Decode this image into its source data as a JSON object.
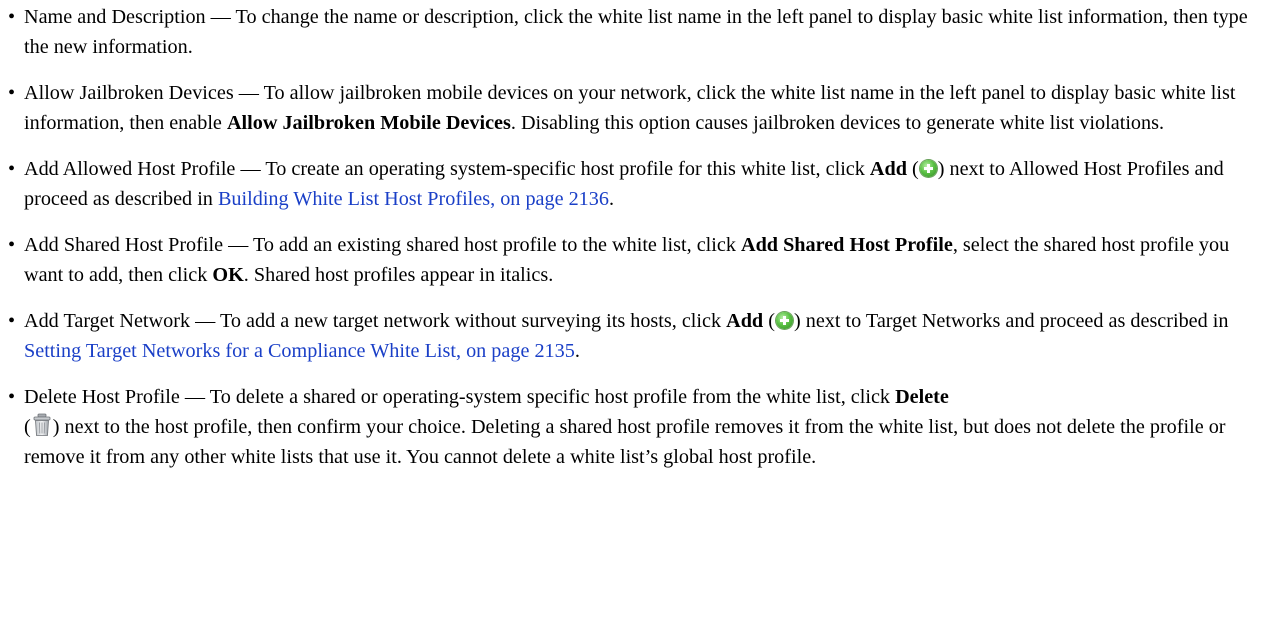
{
  "items": [
    {
      "bullet": "•",
      "text_a": "Name and Description — To change the name or description, click the white list name in the left panel to display basic white list information, then type the new information."
    },
    {
      "bullet": "•",
      "text_a": "Allow Jailbroken Devices — To allow jailbroken mobile devices on your network, click the white list name in the left panel to display basic white list information, then enable ",
      "bold_a": "Allow Jailbroken Mobile Devices",
      "text_b": ". Disabling this option causes jailbroken devices to generate white list violations."
    },
    {
      "bullet": "•",
      "text_a": "Add Allowed Host Profile — To create an operating system-specific host profile for this white list, click ",
      "bold_a": "Add",
      "text_b": " (",
      "text_c": ") next to Allowed Host Profiles and proceed as described in ",
      "link": "Building White List Host Profiles, on page 2136",
      "text_d": "."
    },
    {
      "bullet": "•",
      "text_a": "Add Shared Host Profile — To add an existing shared host profile to the white list, click ",
      "bold_a": "Add Shared Host Profile",
      "text_b": ", select the shared host profile you want to add, then click ",
      "bold_b": "OK",
      "text_c": ". Shared host profiles appear in italics."
    },
    {
      "bullet": "•",
      "text_a": "Add Target Network — To add a new target network without surveying its hosts, click ",
      "bold_a": "Add",
      "text_b": " (",
      "text_c": ") next to Target Networks and proceed as described in ",
      "link": "Setting Target Networks for a Compliance White List, on page 2135",
      "text_d": "."
    },
    {
      "bullet": "•",
      "text_a": "Delete Host Profile — To delete a shared or operating-system specific host profile from the white list, click ",
      "bold_a": "Delete",
      "text_b": "(",
      "text_c": ") next to the host profile, then confirm your choice. Deleting a shared host profile removes it from the white list, but does not delete the profile or remove it from any other white lists that use it. You cannot delete a white list’s global host profile."
    }
  ],
  "icons": {
    "add": "add-circle-icon",
    "delete": "trash-can-icon"
  },
  "colors": {
    "link": "#1a3fc7",
    "add_icon": "#5cc246"
  }
}
